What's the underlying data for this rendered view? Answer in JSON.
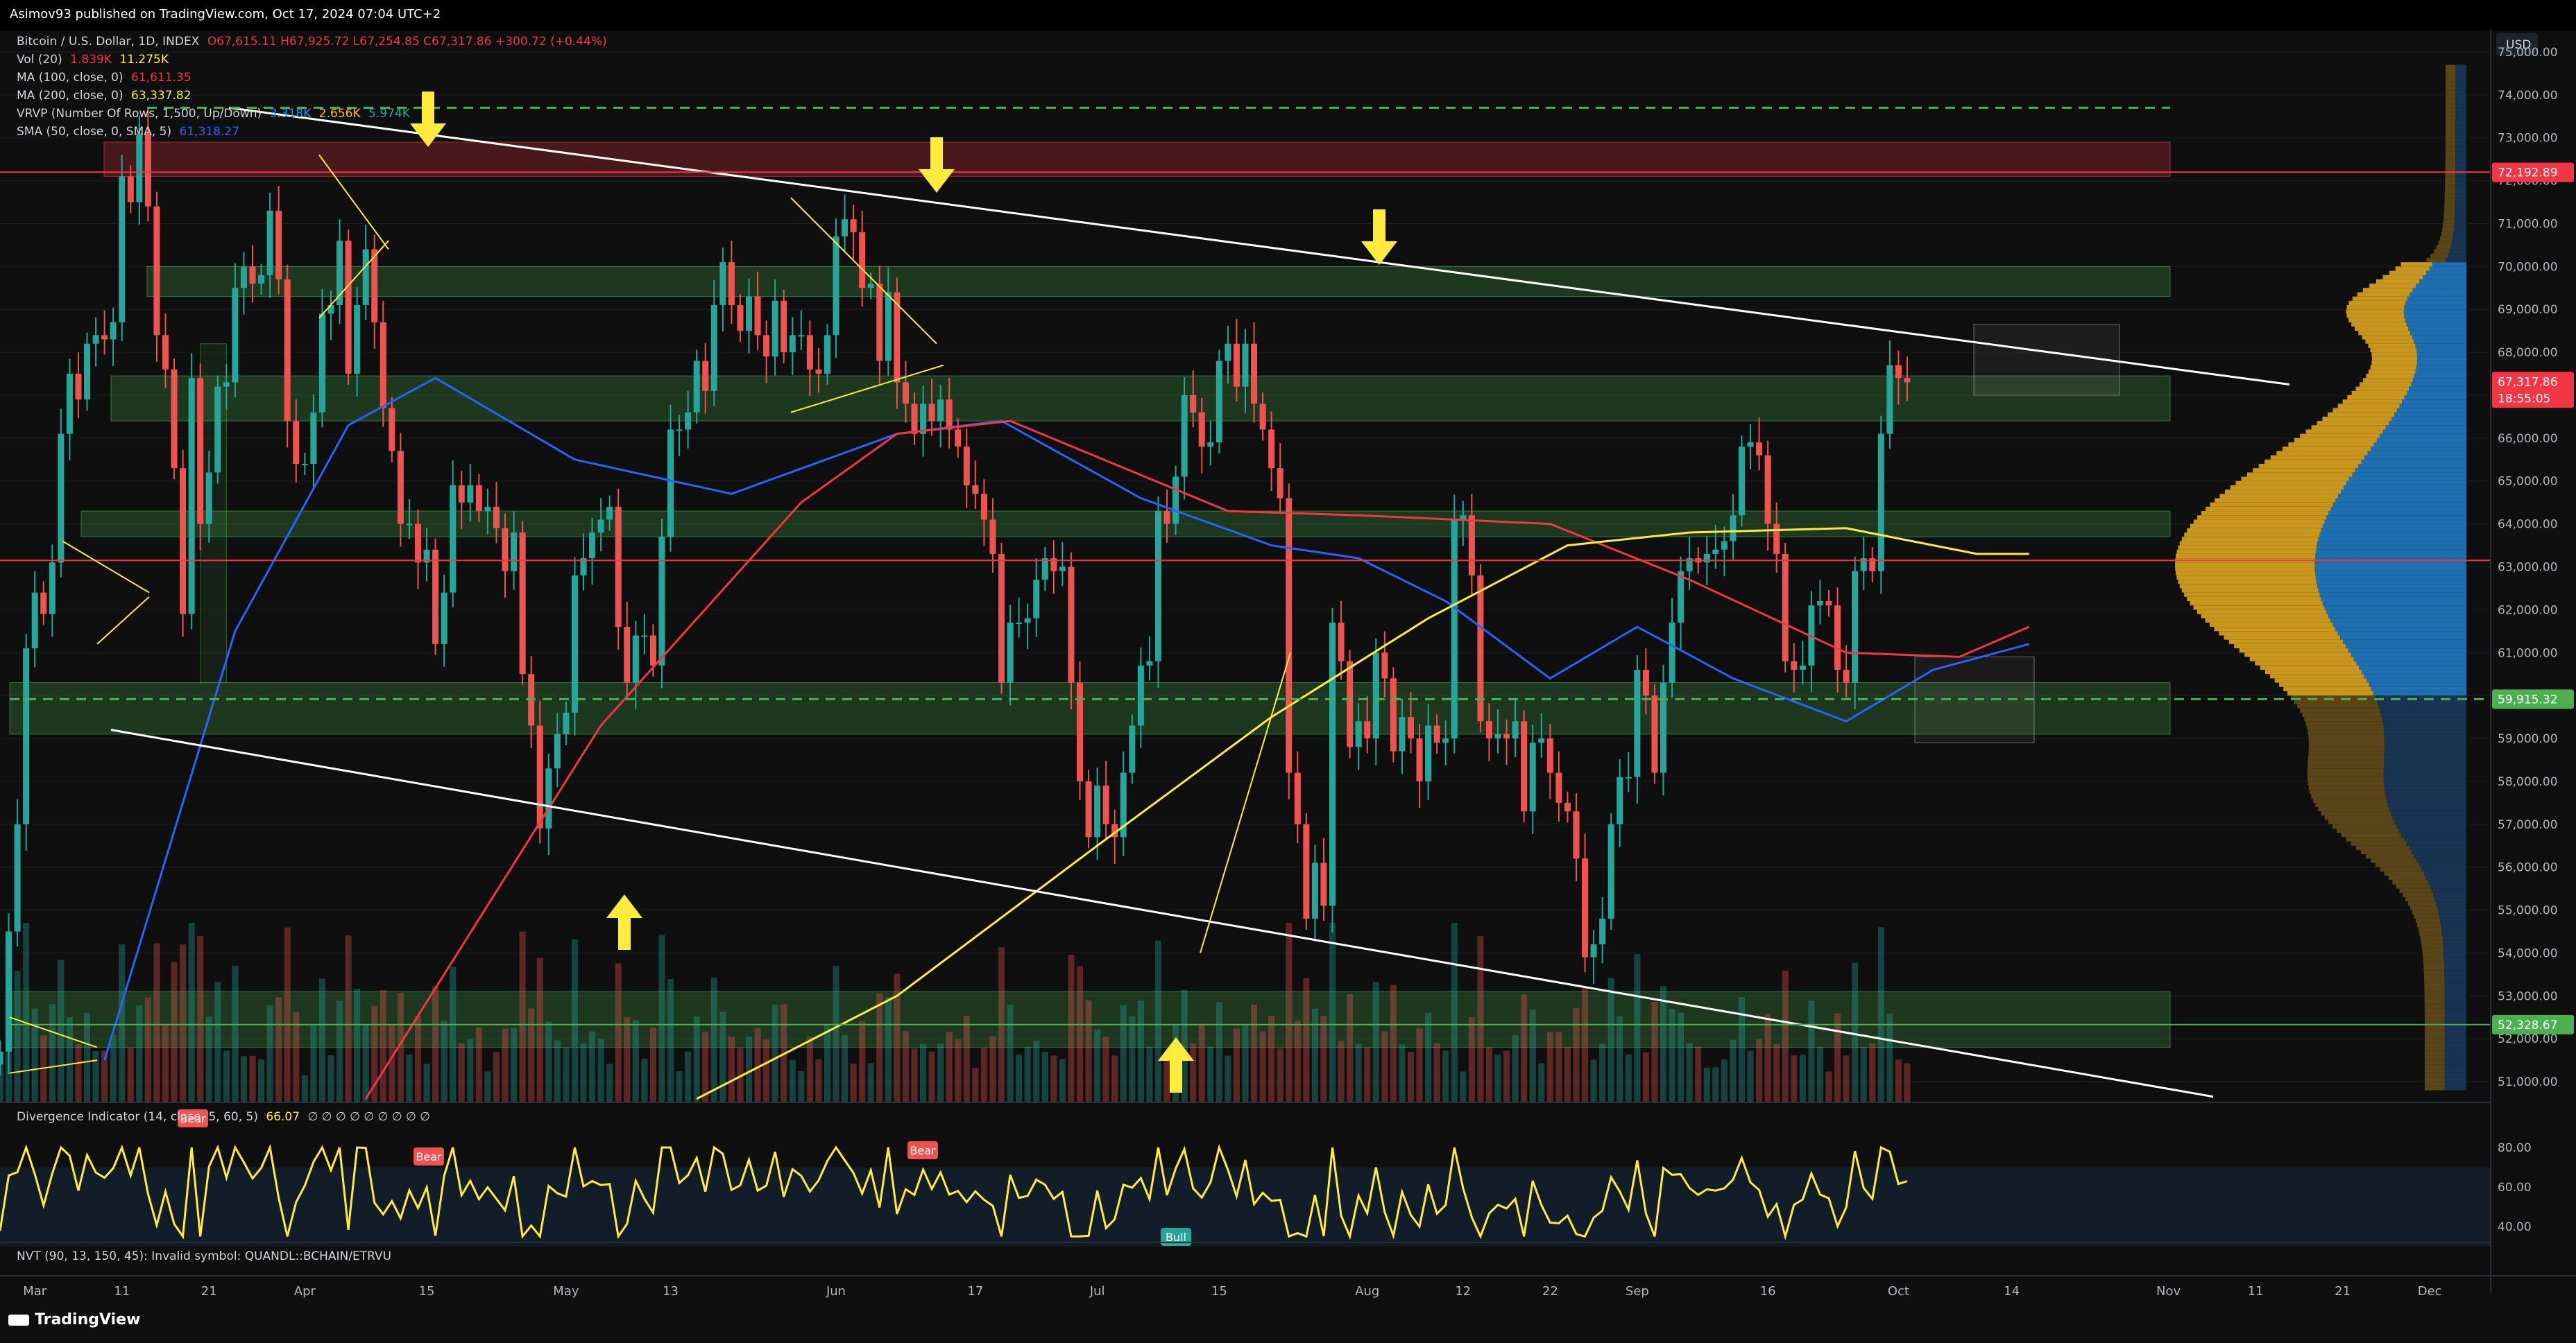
{
  "header": {
    "published": "Asimov93 published on TradingView.com, Oct 17, 2024 07:04 UTC+2"
  },
  "legend": {
    "title": "Bitcoin / U.S. Dollar, 1D, INDEX",
    "ohlc": "O67,615.11 H67,925.72 L67,254.85 C67,317.86 +300.72 (+0.44%)",
    "vol_name": "Vol (20)",
    "vol_v1": "1.839K",
    "vol_v2": "11.275K",
    "ma100_name": "MA (100, close, 0)",
    "ma100_v": "61,611.35",
    "ma200_name": "MA (200, close, 0)",
    "ma200_v": "63,337.82",
    "vrvp_name": "VRVP (Number Of Rows, 1,500, Up/Down)",
    "vrvp_v1": "3.318K",
    "vrvp_v2": "2.656K",
    "vrvp_v3": "5.974K",
    "sma_name": "SMA (50, close, 0, SMA, 5)",
    "sma_v": "61,318.27"
  },
  "osc": {
    "name": "Divergence Indicator (14, close, 5, 60, 5)",
    "value": "66.07",
    "extra": "∅ ∅ ∅ ∅ ∅ ∅ ∅ ∅ ∅",
    "bear_label": "Bear",
    "bull_label": "Bull",
    "ticks": [
      "80.00",
      "60.00",
      "40.00"
    ]
  },
  "nvt": {
    "text": "NVT (90, 13, 150, 45): Invalid symbol: QUANDL::BCHAIN/ETRVU"
  },
  "brand": "TradingView",
  "currency": "USD",
  "price_badges": [
    {
      "label": "72,192.89",
      "color": "#f23645"
    },
    {
      "label": "67,317.86",
      "sub": "18:55:05",
      "color": "#f23645"
    },
    {
      "label": "59,915.32",
      "color": "#4caf50"
    },
    {
      "label": "52,328.67",
      "color": "#4caf50"
    }
  ],
  "chart_data": {
    "type": "candlestick",
    "symbol": "Bitcoin / U.S. Dollar, 1D, INDEX",
    "ylim": [
      50500,
      75500
    ],
    "y_ticks": [
      "51,000.00",
      "52,000.00",
      "53,000.00",
      "54,000.00",
      "55,000.00",
      "56,000.00",
      "57,000.00",
      "58,000.00",
      "59,000.00",
      "60,000.00",
      "61,000.00",
      "62,000.00",
      "63,000.00",
      "64,000.00",
      "65,000.00",
      "66,000.00",
      "67,000.00",
      "68,000.00",
      "69,000.00",
      "70,000.00",
      "71,000.00",
      "72,000.00",
      "73,000.00",
      "74,000.00",
      "75,000.00"
    ],
    "x_range": [
      "2024-02-26",
      "2024-12-08"
    ],
    "x_ticks": [
      {
        "label": "Mar",
        "date": "2024-03-01"
      },
      {
        "label": "11",
        "date": "2024-03-11"
      },
      {
        "label": "21",
        "date": "2024-03-21"
      },
      {
        "label": "Apr",
        "date": "2024-04-01"
      },
      {
        "label": "15",
        "date": "2024-04-15"
      },
      {
        "label": "May",
        "date": "2024-05-01"
      },
      {
        "label": "13",
        "date": "2024-05-13"
      },
      {
        "label": "Jun",
        "date": "2024-06-01"
      },
      {
        "label": "17",
        "date": "2024-06-17"
      },
      {
        "label": "Jul",
        "date": "2024-07-01"
      },
      {
        "label": "15",
        "date": "2024-07-15"
      },
      {
        "label": "Aug",
        "date": "2024-08-01"
      },
      {
        "label": "12",
        "date": "2024-08-12"
      },
      {
        "label": "22",
        "date": "2024-08-22"
      },
      {
        "label": "Sep",
        "date": "2024-09-01"
      },
      {
        "label": "16",
        "date": "2024-09-16"
      },
      {
        "label": "Oct",
        "date": "2024-10-01"
      },
      {
        "label": "14",
        "date": "2024-10-14"
      },
      {
        "label": "Nov",
        "date": "2024-11-01"
      },
      {
        "label": "11",
        "date": "2024-11-11"
      },
      {
        "label": "21",
        "date": "2024-11-21"
      },
      {
        "label": "Dec",
        "date": "2024-12-01"
      }
    ],
    "closes_start": "2024-02-26",
    "closes": [
      51700,
      54500,
      57000,
      61100,
      62400,
      61900,
      63100,
      66100,
      67500,
      66900,
      68200,
      68400,
      68300,
      68700,
      72100,
      71500,
      73100,
      71400,
      68400,
      67600,
      65300,
      61900,
      67400,
      64000,
      65200,
      67200,
      67300,
      69500,
      70000,
      69600,
      69800,
      71300,
      69700,
      66400,
      65400,
      65400,
      66600,
      68900,
      69100,
      70600,
      67500,
      69100,
      70400,
      68700,
      66700,
      65700,
      64000,
      64000,
      63100,
      63400,
      61200,
      62400,
      64900,
      64500,
      64900,
      64300,
      64400,
      63900,
      62900,
      63800,
      60500,
      59300,
      56900,
      58300,
      59100,
      59600,
      62800,
      63200,
      63800,
      64100,
      64400,
      61600,
      60300,
      61400,
      61400,
      60700,
      63700,
      66200,
      66200,
      66600,
      67800,
      67100,
      69100,
      70100,
      69100,
      68500,
      69300,
      68400,
      67900,
      69200,
      68000,
      68400,
      68400,
      67600,
      67500,
      68400,
      70700,
      71100,
      70800,
      69500,
      69600,
      67800,
      69400,
      67300,
      66800,
      66100,
      66800,
      66400,
      66900,
      66200,
      65800,
      64900,
      64700,
      64100,
      63300,
      60300,
      61700,
      61700,
      61800,
      62700,
      63200,
      62900,
      63000,
      60300,
      58000,
      56700,
      57900,
      57000,
      56700,
      58200,
      59300,
      60700,
      60800,
      64300,
      64000,
      65100,
      67000,
      66600,
      65800,
      65900,
      67800,
      68200,
      67200,
      68200,
      66800,
      66200,
      65300,
      64600,
      58200,
      57000,
      54800,
      56100,
      55100,
      61700,
      60800,
      58800,
      59400,
      59000,
      61000,
      60400,
      58700,
      59500,
      59000,
      58000,
      59300,
      58900,
      59000,
      64100,
      64200,
      62800,
      59400,
      59000,
      59100,
      59000,
      59400,
      57300,
      58900,
      59000,
      58200,
      57500,
      57300,
      56200,
      53900,
      54200,
      54800,
      57000,
      58100,
      58100,
      60600,
      60000,
      58200,
      60300,
      61700,
      62900,
      63200,
      63100,
      63300,
      63400,
      63600,
      64200,
      65800,
      65900,
      65600,
      64000,
      63300,
      60800,
      60600,
      60700,
      62100,
      62200,
      62100,
      60600,
      60300,
      62900,
      63200,
      62900,
      66100,
      67700,
      67400,
      67300
    ],
    "series": [
      {
        "name": "SMA (50, close, 0, SMA, 5)",
        "color": "#2962ff",
        "points": [
          [
            "2024-03-09",
            51500
          ],
          [
            "2024-03-24",
            61500
          ],
          [
            "2024-04-06",
            66300
          ],
          [
            "2024-04-16",
            67400
          ],
          [
            "2024-05-02",
            65500
          ],
          [
            "2024-05-20",
            64700
          ],
          [
            "2024-06-08",
            66100
          ],
          [
            "2024-06-20",
            66400
          ],
          [
            "2024-07-06",
            64600
          ],
          [
            "2024-07-21",
            63500
          ],
          [
            "2024-07-31",
            63200
          ],
          [
            "2024-08-10",
            62200
          ],
          [
            "2024-08-22",
            60400
          ],
          [
            "2024-09-01",
            61600
          ],
          [
            "2024-09-12",
            60400
          ],
          [
            "2024-09-25",
            59400
          ],
          [
            "2024-10-05",
            60600
          ],
          [
            "2024-10-16",
            61200
          ]
        ]
      },
      {
        "name": "MA (100, close, 0)",
        "color": "#f23645",
        "points": [
          [
            "2024-04-08",
            50600
          ],
          [
            "2024-05-05",
            59300
          ],
          [
            "2024-05-28",
            64500
          ],
          [
            "2024-06-08",
            66100
          ],
          [
            "2024-06-21",
            66400
          ],
          [
            "2024-07-16",
            64300
          ],
          [
            "2024-07-31",
            64200
          ],
          [
            "2024-08-22",
            64000
          ],
          [
            "2024-09-07",
            62700
          ],
          [
            "2024-09-25",
            61000
          ],
          [
            "2024-10-08",
            60900
          ],
          [
            "2024-10-16",
            61600
          ]
        ]
      },
      {
        "name": "MA (200, close, 0)",
        "color": "#ffeb3b",
        "points": [
          [
            "2024-05-16",
            50600
          ],
          [
            "2024-06-08",
            53000
          ],
          [
            "2024-07-01",
            56500
          ],
          [
            "2024-07-21",
            59500
          ],
          [
            "2024-08-08",
            61800
          ],
          [
            "2024-08-24",
            63500
          ],
          [
            "2024-09-07",
            63800
          ],
          [
            "2024-09-25",
            63900
          ],
          [
            "2024-10-10",
            63300
          ],
          [
            "2024-10-16",
            63300
          ]
        ]
      }
    ]
  }
}
